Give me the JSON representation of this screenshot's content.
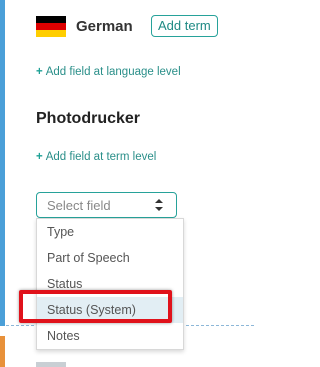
{
  "language": {
    "name": "German",
    "add_term_label": "Add term",
    "flag_colors": [
      "#000000",
      "#dd0000",
      "#ffce00"
    ]
  },
  "links": {
    "add_language_field": "Add field at language level",
    "add_term_field": "Add field at term level"
  },
  "term": {
    "title": "Photodrucker"
  },
  "field_select": {
    "placeholder": "Select field",
    "options": [
      {
        "label": "Type"
      },
      {
        "label": "Part of Speech"
      },
      {
        "label": "Status"
      },
      {
        "label": "Status (System)"
      },
      {
        "label": "Notes"
      }
    ],
    "highlighted_option": "Status (System)"
  },
  "colors": {
    "accent": "#27a29a",
    "highlight_outline": "#e0121b",
    "left_bar": "#4a9fd8",
    "left_bar_next": "#e8913a"
  }
}
